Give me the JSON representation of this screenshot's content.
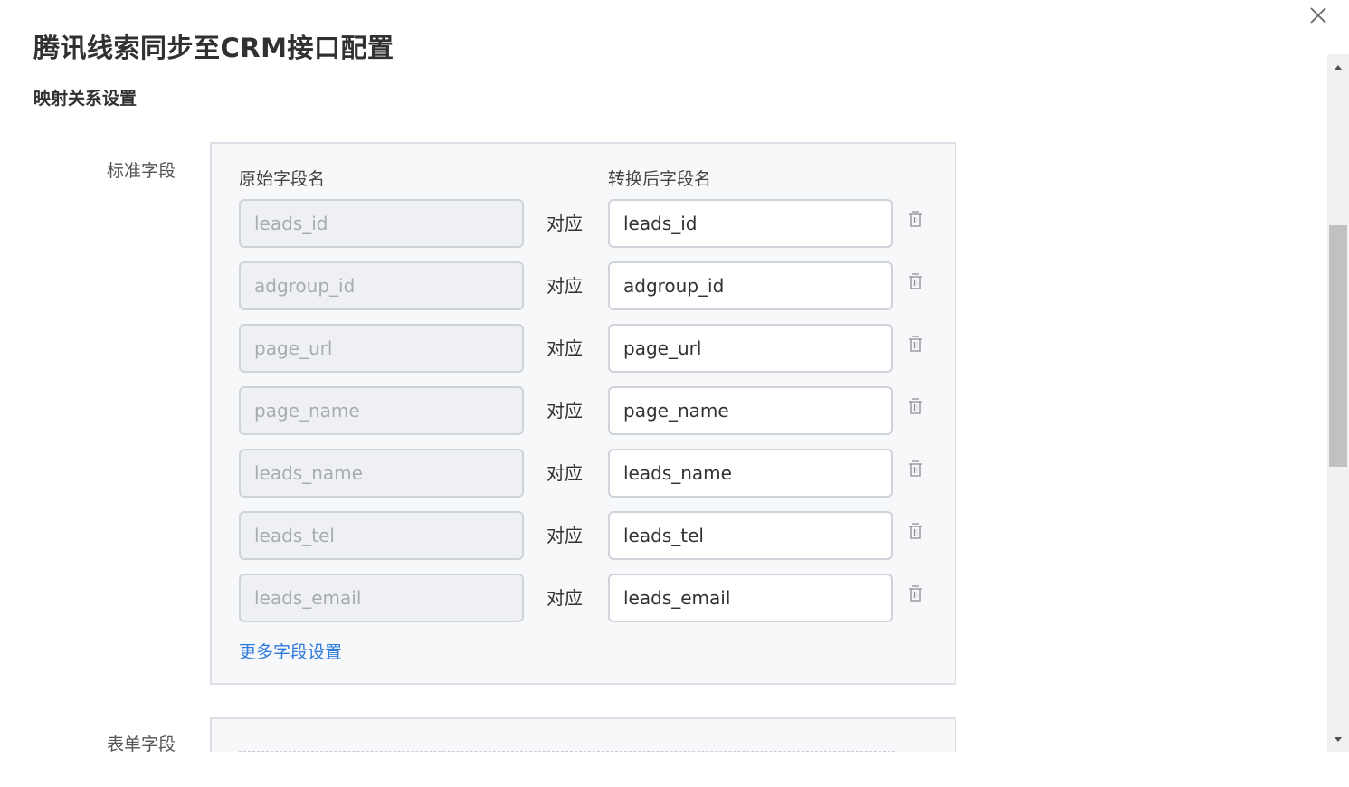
{
  "dialog": {
    "title": "腾讯线索同步至CRM接口配置",
    "section_title": "映射关系设置",
    "close_icon": "close-icon"
  },
  "standard_fields": {
    "label": "标准字段",
    "header_original": "原始字段名",
    "header_converted": "转换后字段名",
    "correspond_label": "对应",
    "rows": [
      {
        "original": "leads_id",
        "converted": "leads_id"
      },
      {
        "original": "adgroup_id",
        "converted": "adgroup_id"
      },
      {
        "original": "page_url",
        "converted": "page_url"
      },
      {
        "original": "page_name",
        "converted": "page_name"
      },
      {
        "original": "leads_name",
        "converted": "leads_name"
      },
      {
        "original": "leads_tel",
        "converted": "leads_tel"
      },
      {
        "original": "leads_email",
        "converted": "leads_email"
      }
    ],
    "more_link": "更多字段设置",
    "delete_icon": "trash-icon"
  },
  "form_fields": {
    "label": "表单字段"
  },
  "scrollbar": {
    "up_icon": "arrow-up-icon",
    "down_icon": "arrow-down-icon"
  },
  "colors": {
    "link": "#2f7bdc",
    "panel_bg": "#f7f8fa",
    "panel_border": "#dcdfe6",
    "disabled_bg": "#eef0f3"
  }
}
